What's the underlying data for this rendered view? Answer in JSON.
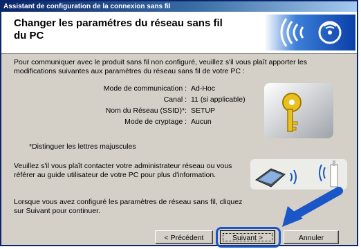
{
  "window": {
    "title": "Assistant de configuration de la connexion sans fil"
  },
  "header": {
    "title": "Changer les paramétres du réseau sans fil du PC",
    "logo_icon": "wireless-signal-icon"
  },
  "intro": "Pour communiquer avec le produit sans fil non configuré, veuillez s'il vous plaît apporter les modifications suivantes aux paramètres du réseau sans fil de votre PC :",
  "params": [
    {
      "label": "Mode de communication :",
      "value": "Ad-Hoc"
    },
    {
      "label": "Canal :",
      "value": "11   (si applicable)"
    },
    {
      "label": "Nom du Réseau (SSID)*:",
      "value": "SETUP"
    },
    {
      "label": "Mode de cryptage :",
      "value": "Aucun"
    }
  ],
  "note": "*Distinguer les lettres majuscules",
  "contact": "Veuillez s'il vous plaît contacter votre administrateur réseau ou vous référer au guide utilisateur de votre PC pour plus d'information.",
  "finish": "Lorsque vous avez configuré les paramètres de réseau sans fil, cliquez sur Suivant pour continuer.",
  "buttons": {
    "prev": "< Précédent",
    "next": "Suivant >",
    "cancel": "Annuler"
  },
  "colors": {
    "accent": "#1a56c8",
    "titlebar": "#0a246a",
    "dialog_bg": "#d4d0c8"
  },
  "icons": [
    "key-icon",
    "laptop-icon",
    "access-point-icon",
    "pointer-arrow-icon"
  ]
}
